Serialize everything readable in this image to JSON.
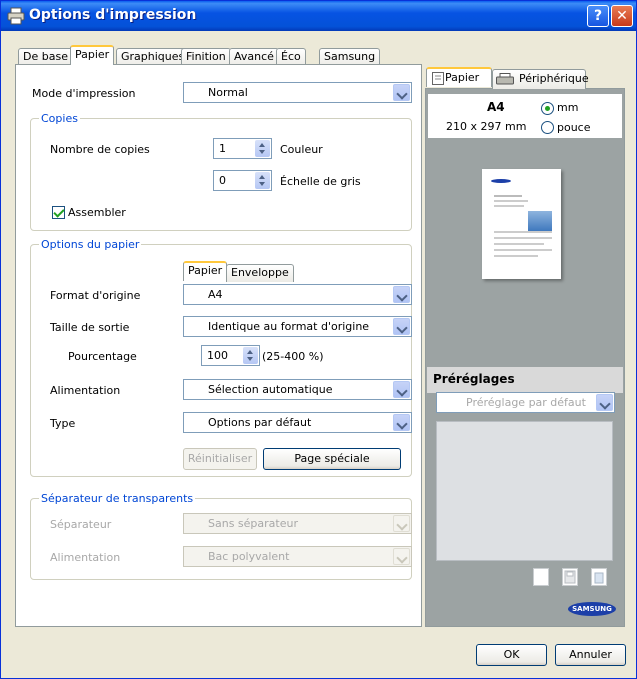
{
  "window": {
    "title": "Options d'impression",
    "help_label": "?",
    "close_label": "✕"
  },
  "tabs": [
    "De base",
    "Papier",
    "Graphiques",
    "Finition",
    "Avancé",
    "Éco",
    "Samsung"
  ],
  "active_tab": "Papier",
  "print_mode": {
    "label": "Mode d'impression",
    "value": "Normal"
  },
  "copies": {
    "group_title": "Copies",
    "count_label": "Nombre de copies",
    "color_value": "1",
    "color_label": "Couleur",
    "gray_value": "0",
    "gray_label": "Échelle de gris",
    "collate_label": "Assembler"
  },
  "paper_options": {
    "group_title": "Options du papier",
    "subtabs": [
      "Papier",
      "Enveloppe"
    ],
    "original_size_label": "Format d'origine",
    "original_size_value": "A4",
    "output_size_label": "Taille de sortie",
    "output_size_value": "Identique au format d'origine",
    "percent_label": "Pourcentage",
    "percent_value": "100",
    "percent_range": "(25-400 %)",
    "source_label": "Alimentation",
    "source_value": "Sélection automatique",
    "type_label": "Type",
    "type_value": "Options par défaut",
    "reset_label": "Réinitialiser",
    "special_page_label": "Page spéciale"
  },
  "transparency": {
    "group_title": "Séparateur de transparents",
    "separator_label": "Séparateur",
    "separator_value": "Sans séparateur",
    "source_label": "Alimentation",
    "source_value": "Bac polyvalent"
  },
  "preview": {
    "tabs": [
      "Papier",
      "Périphérique"
    ],
    "paper_name": "A4",
    "paper_dims": "210 x 297 mm",
    "unit_mm": "mm",
    "unit_inch": "pouce",
    "presets_label": "Préréglages",
    "presets_value": "Préréglage par défaut"
  },
  "logo_text": "SAMSUNG",
  "buttons": {
    "ok": "OK",
    "cancel": "Annuler"
  }
}
